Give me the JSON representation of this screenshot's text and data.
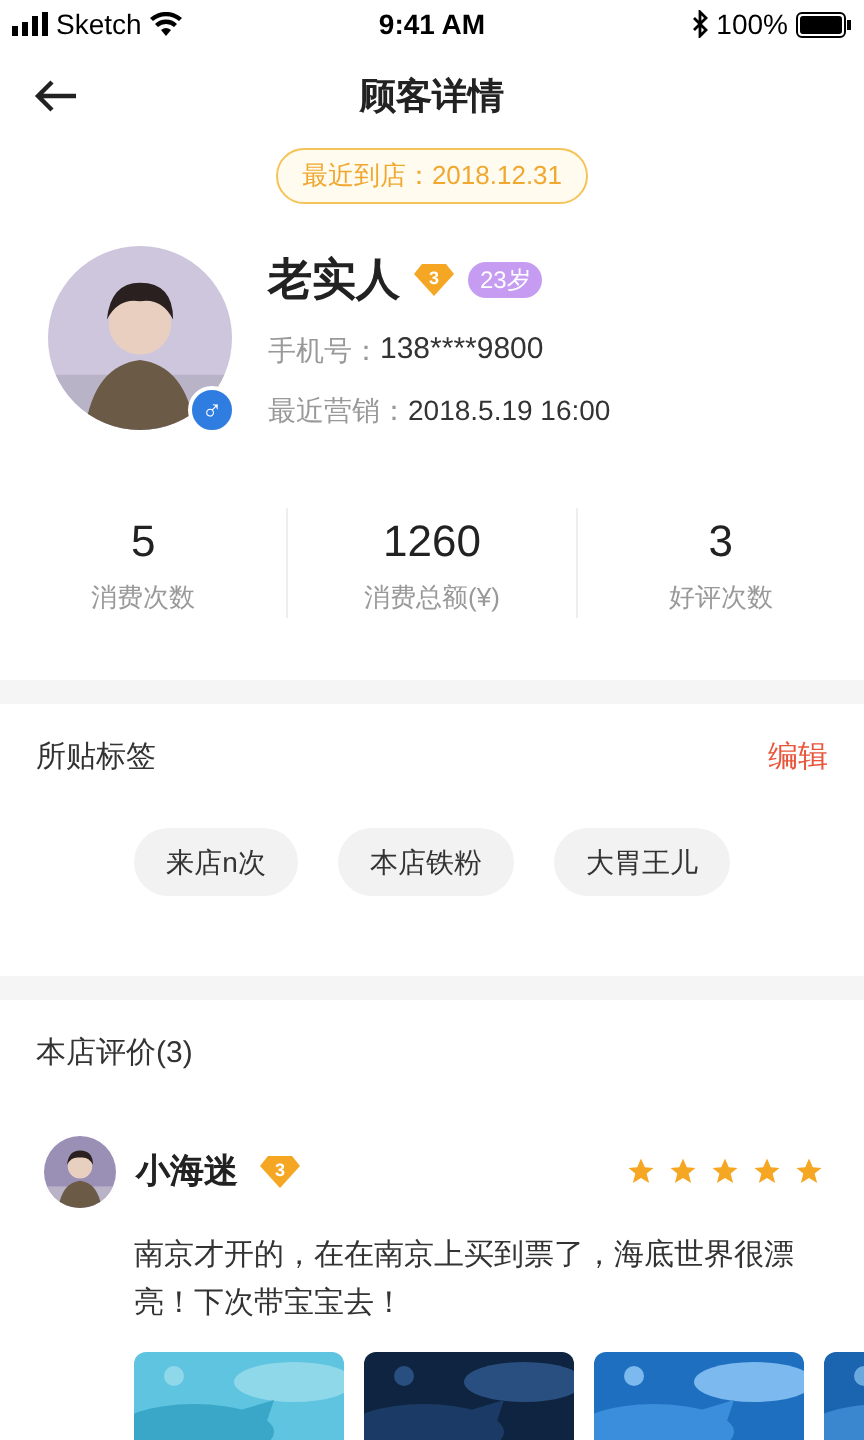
{
  "status_bar": {
    "carrier": "Sketch",
    "time": "9:41 AM",
    "battery": "100%"
  },
  "nav": {
    "title": "顾客详情"
  },
  "last_visit": "最近到店：2018.12.31",
  "profile": {
    "name": "老实人",
    "vip_level": "3",
    "age": "23岁",
    "gender": "♂",
    "phone_label": "手机号：",
    "phone": "138****9800",
    "marketing_label": "最近营销：",
    "marketing": "2018.5.19 16:00"
  },
  "stats": [
    {
      "value": "5",
      "label": "消费次数"
    },
    {
      "value": "1260",
      "label": "消费总额(¥)"
    },
    {
      "value": "3",
      "label": "好评次数"
    }
  ],
  "tags_section": {
    "title": "所贴标签",
    "action": "编辑",
    "tags": [
      "来店n次",
      "本店铁粉",
      "大胃王儿"
    ]
  },
  "reviews_section": {
    "title": "本店评价(3)",
    "reviews": [
      {
        "name": "小海迷",
        "vip_level": "3",
        "stars": 5,
        "text": "南京才开的，在在南京上买到票了，海底世界很漂亮！下次带宝宝去！",
        "photos": [
          {
            "kind": "picture"
          },
          {
            "kind": "picture"
          },
          {
            "kind": "picture"
          },
          {
            "kind": "picture"
          }
        ]
      }
    ]
  }
}
